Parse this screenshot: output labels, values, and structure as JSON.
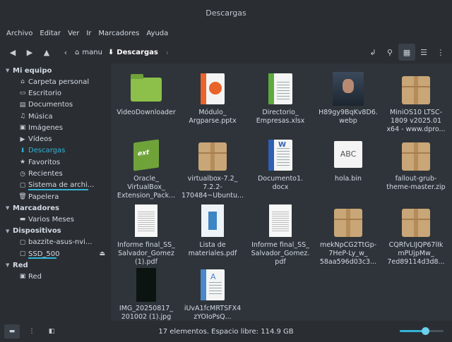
{
  "window": {
    "title": "Descargas"
  },
  "menu": [
    "Archivo",
    "Editar",
    "Ver",
    "Ir",
    "Marcadores",
    "Ayuda"
  ],
  "breadcrumb": {
    "parent": "manu",
    "current": "Descargas"
  },
  "sidebar": {
    "mi_equipo": {
      "title": "Mi equipo",
      "items": [
        "Carpeta personal",
        "Escritorio",
        "Documentos",
        "Música",
        "Imágenes",
        "Vídeos",
        "Descargas",
        "Favoritos",
        "Recientes",
        "Sistema de archi...",
        "Papelera"
      ]
    },
    "marcadores": {
      "title": "Marcadores",
      "items": [
        "Varios Meses"
      ]
    },
    "dispositivos": {
      "title": "Dispositivos",
      "items": [
        "bazzite-asus-nvi...",
        "SSD_500"
      ]
    },
    "red": {
      "title": "Red",
      "items": [
        "Red"
      ]
    }
  },
  "files": [
    {
      "name": "VideoDownloader",
      "icon": "folder-icon"
    },
    {
      "name": "Módulo_\nArgparse.pptx",
      "icon": "presentation-icon"
    },
    {
      "name": "Directorio_\nEmpresas.xlsx",
      "icon": "spreadsheet-icon"
    },
    {
      "name": "H89gy9BqKv8D6.\nwebp",
      "icon": "image-thumbnail"
    },
    {
      "name": "MiniOS10 LTSC-\n1809 v2025.01\nx64 - www.dpro...",
      "icon": "archive-icon"
    },
    {
      "name": "Oracle_\nVirtualBox_\nExtension_Pack...",
      "icon": "extension-pack-icon"
    },
    {
      "name": "virtualbox-7.2_\n7.2.2-\n170484~Ubuntu...",
      "icon": "archive-icon"
    },
    {
      "name": "Documento1.\ndocx",
      "icon": "word-document-icon"
    },
    {
      "name": "hola.bin",
      "icon": "binary-file-icon"
    },
    {
      "name": "fallout-grub-\ntheme-master.zip",
      "icon": "archive-icon"
    },
    {
      "name": "Informe final_SS_\nSalvador_Gomez\n(1).pdf",
      "icon": "pdf-thumbnail"
    },
    {
      "name": "Lista de\nmateriales.pdf",
      "icon": "pdf-thumbnail"
    },
    {
      "name": "Informe final_SS_\nSalvador_Gomez.\npdf",
      "icon": "pdf-thumbnail"
    },
    {
      "name": "mekNpCG2TtGp-\n7HeP-Ly_w_\n58aa596d03c3...",
      "icon": "archive-icon"
    },
    {
      "name": "CQRfvLIJQP67lIk\nmPUjpMw_\n7ed89114d3d8...",
      "icon": "archive-icon"
    },
    {
      "name": "IMG_20250817_\n201002 (1).jpg",
      "icon": "image-thumbnail"
    },
    {
      "name": "iUvA1fcMRTSFX4\nzYOIoPsQ...",
      "icon": "text-document-icon"
    }
  ],
  "icon_glyphs": {
    "abc": "ABC",
    "word": "W",
    "ext": "ext",
    "text_doc": "A"
  },
  "status": {
    "text": "17 elementos. Espacio libre: 114.9 GB",
    "zoom": 0.58
  },
  "colors": {
    "accent": "#33b3d6",
    "folder": "#8cc04a",
    "archive": "#c9a677"
  }
}
